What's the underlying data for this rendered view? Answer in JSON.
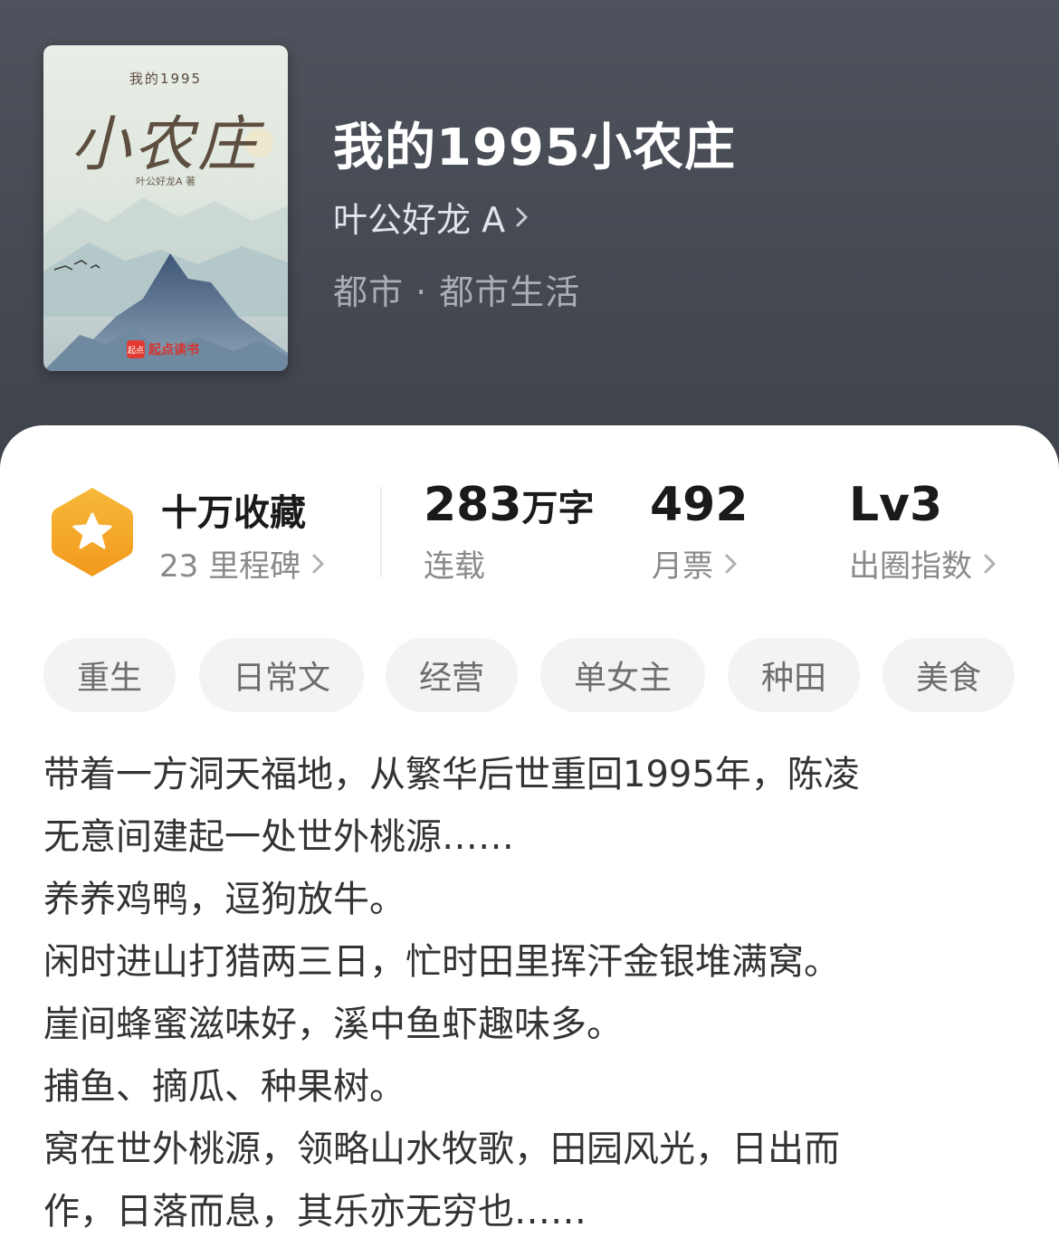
{
  "book": {
    "cover": {
      "small_title": "我的1995",
      "big_title": "小农庄",
      "author": "叶公好龙A 著",
      "publisher_mark": "起点",
      "publisher": "起点读书"
    },
    "title": "我的1995小农庄",
    "author": "叶公好龙 A",
    "genre": "都市 · 都市生活"
  },
  "stats": {
    "collection": {
      "label": "十万收藏",
      "sub": "23 里程碑",
      "icon": "star-badge-icon"
    },
    "words": {
      "number": "283",
      "unit": "万字",
      "sub": "连载"
    },
    "monthly_votes": {
      "number": "492",
      "sub": "月票"
    },
    "influence": {
      "number": "Lv3",
      "sub": "出圈指数"
    }
  },
  "tags": [
    "重生",
    "日常文",
    "经营",
    "单女主",
    "种田",
    "美食"
  ],
  "description": [
    "带着一方洞天福地，从繁华后世重回1995年，陈凌",
    "无意间建起一处世外桃源……",
    "养养鸡鸭，逗狗放牛。",
    "闲时进山打猎两三日，忙时田里挥汗金银堆满窝。",
    "崖间蜂蜜滋味好，溪中鱼虾趣味多。",
    "捕鱼、摘瓜、种果树。",
    "窝在世外桃源，领略山水牧歌，田园风光，日出而",
    "作，日落而息，其乐亦无穷也……"
  ],
  "colors": {
    "header_bg": "#4a4e57",
    "badge_orange": "#f5a623",
    "tag_bg": "#f3f3f3"
  }
}
